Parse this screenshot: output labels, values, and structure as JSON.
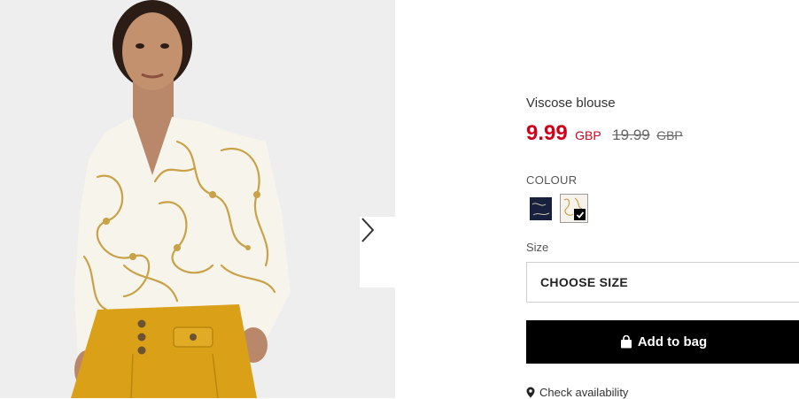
{
  "product": {
    "name": "Viscose blouse",
    "price": "9.99",
    "currency": "GBP",
    "old_price": "19.99",
    "old_currency": "GBP"
  },
  "colour": {
    "label": "COLOUR",
    "options": [
      {
        "name": "navy",
        "color": "#17213d",
        "selected": false
      },
      {
        "name": "cream-print",
        "color": "#f6f3ec",
        "selected": true
      }
    ]
  },
  "size": {
    "label": "Size",
    "value": "CHOOSE SIZE"
  },
  "actions": {
    "add_to_bag": "Add to bag",
    "check_availability": "Check availability"
  },
  "colors": {
    "sale_red": "#d0021b",
    "button_black": "#000000",
    "skirt_mustard": "#d9a018"
  }
}
